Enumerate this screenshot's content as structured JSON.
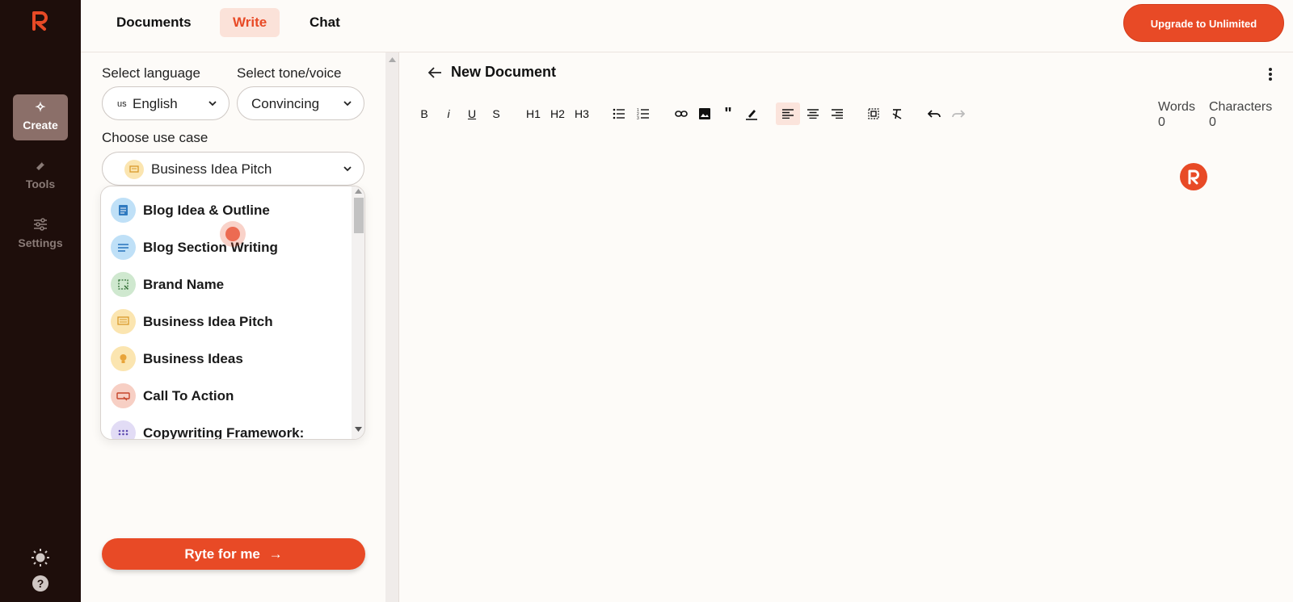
{
  "rail": {
    "items": [
      {
        "label": "Create",
        "icon": "sparkles-icon",
        "active": true
      },
      {
        "label": "Tools",
        "icon": "wrench-icon",
        "active": false
      },
      {
        "label": "Settings",
        "icon": "sliders-icon",
        "active": false
      }
    ],
    "bottom_icons": [
      "sun-icon",
      "help-icon"
    ]
  },
  "header": {
    "tabs": [
      {
        "label": "Documents",
        "active": false
      },
      {
        "label": "Write",
        "active": true
      },
      {
        "label": "Chat",
        "active": false
      }
    ],
    "upgrade_label": "Upgrade to Unlimited"
  },
  "form": {
    "language_label": "Select language",
    "language_flag": "us",
    "language_value": "English",
    "tone_label": "Select tone/voice",
    "tone_value": "Convincing",
    "usecase_label": "Choose use case",
    "usecase_value": "Business Idea Pitch",
    "submit_label": "Ryte for me"
  },
  "dropdown": {
    "items": [
      {
        "label": "Blog Idea & Outline",
        "color": "#bfe0f7",
        "icon": "document-icon"
      },
      {
        "label": "Blog Section Writing",
        "color": "#bfe0f7",
        "icon": "lines-icon"
      },
      {
        "label": "Brand Name",
        "color": "#cfe8cf",
        "icon": "selection-icon"
      },
      {
        "label": "Business Idea Pitch",
        "color": "#fbe5b0",
        "icon": "presentation-icon"
      },
      {
        "label": "Business Ideas",
        "color": "#fbe5b0",
        "icon": "lightbulb-icon"
      },
      {
        "label": "Call To Action",
        "color": "#f7cfc4",
        "icon": "button-icon"
      },
      {
        "label": "Copywriting Framework:",
        "color": "#e2dcf5",
        "icon": "grid-icon"
      }
    ]
  },
  "editor": {
    "title": "New Document",
    "toolbar": {
      "bold": "B",
      "italic": "i",
      "underline": "U",
      "strike": "S",
      "h1": "H1",
      "h2": "H2",
      "h3": "H3"
    },
    "words_label": "Words",
    "words_value": "0",
    "chars_label": "Characters",
    "chars_value": "0"
  },
  "colors": {
    "accent": "#e84a26",
    "rail_bg": "#1e0e0b",
    "page_bg": "#fdfbf8"
  }
}
